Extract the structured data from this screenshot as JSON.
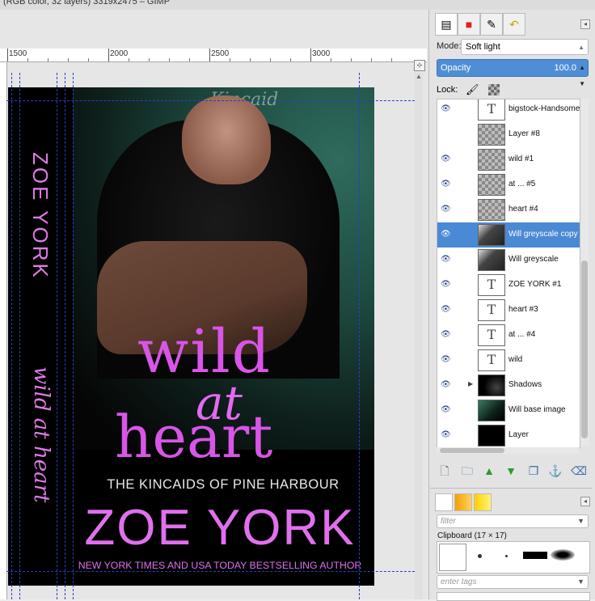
{
  "window": {
    "title": "(RGB color, 32 layers) 3319x2475 – GIMP"
  },
  "ruler": {
    "marks": [
      "1500",
      "2000",
      "2500",
      "3000"
    ]
  },
  "cover": {
    "spine_author": "ZOE YORK",
    "spine_title": "wild at heart",
    "title_line1": "wild",
    "title_line2": "at",
    "title_line3": "heart",
    "series": "THE KINCAIDS OF PINE HARBOUR",
    "author": "ZOE YORK",
    "tagline": "NEW YORK TIMES AND USA TODAY BESTSELLING AUTHOR",
    "board_text": "Kincaid\nhool\nty"
  },
  "layers_panel": {
    "mode_label": "Mode:",
    "mode_value": "Soft light",
    "opacity_label": "Opacity",
    "opacity_value": "100.0",
    "lock_label": "Lock:",
    "layers": [
      {
        "name": "bigstock-Handsome",
        "thumb": "text",
        "visible": true,
        "selected": false,
        "group": false
      },
      {
        "name": "Layer #8",
        "thumb": "checker",
        "visible": false,
        "selected": false,
        "group": false
      },
      {
        "name": "wild #1",
        "thumb": "checker",
        "visible": true,
        "selected": false,
        "group": false
      },
      {
        "name": "at  ... #5",
        "thumb": "checker",
        "visible": true,
        "selected": false,
        "group": false
      },
      {
        "name": "heart #4",
        "thumb": "checker",
        "visible": true,
        "selected": false,
        "group": false
      },
      {
        "name": "Will greyscale copy",
        "thumb": "photo",
        "visible": true,
        "selected": true,
        "group": false
      },
      {
        "name": "Will greyscale",
        "thumb": "photo",
        "visible": true,
        "selected": false,
        "group": false
      },
      {
        "name": "ZOE YORK #1",
        "thumb": "text",
        "visible": true,
        "selected": false,
        "group": false
      },
      {
        "name": "heart #3",
        "thumb": "text",
        "visible": true,
        "selected": false,
        "group": false
      },
      {
        "name": "at  ... #4",
        "thumb": "text",
        "visible": true,
        "selected": false,
        "group": false
      },
      {
        "name": "wild",
        "thumb": "text",
        "visible": true,
        "selected": false,
        "group": false
      },
      {
        "name": "Shadows",
        "thumb": "dark",
        "visible": true,
        "selected": false,
        "group": true
      },
      {
        "name": "Will base image",
        "thumb": "color",
        "visible": true,
        "selected": false,
        "group": false
      },
      {
        "name": "Layer",
        "thumb": "black",
        "visible": true,
        "selected": false,
        "group": false
      }
    ]
  },
  "brushes_panel": {
    "filter_placeholder": "filter",
    "clipboard_label": "Clipboard (17 × 17)",
    "tags_placeholder": "enter tags"
  },
  "colors": {
    "accent": "#4a89d4",
    "cover_pink": "#e070ee",
    "guide_blue": "#2a3dc9"
  }
}
